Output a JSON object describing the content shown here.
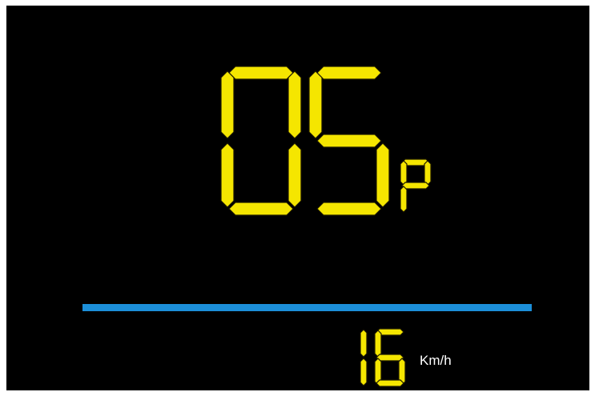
{
  "display": {
    "assist_level": "05",
    "assist_mode": "P",
    "speed": "16",
    "speed_unit": "Km/h"
  },
  "colors": {
    "background": "#000000",
    "segment": "#f5e600",
    "divider": "#1c8fd9",
    "unit_text": "#ffffff"
  }
}
